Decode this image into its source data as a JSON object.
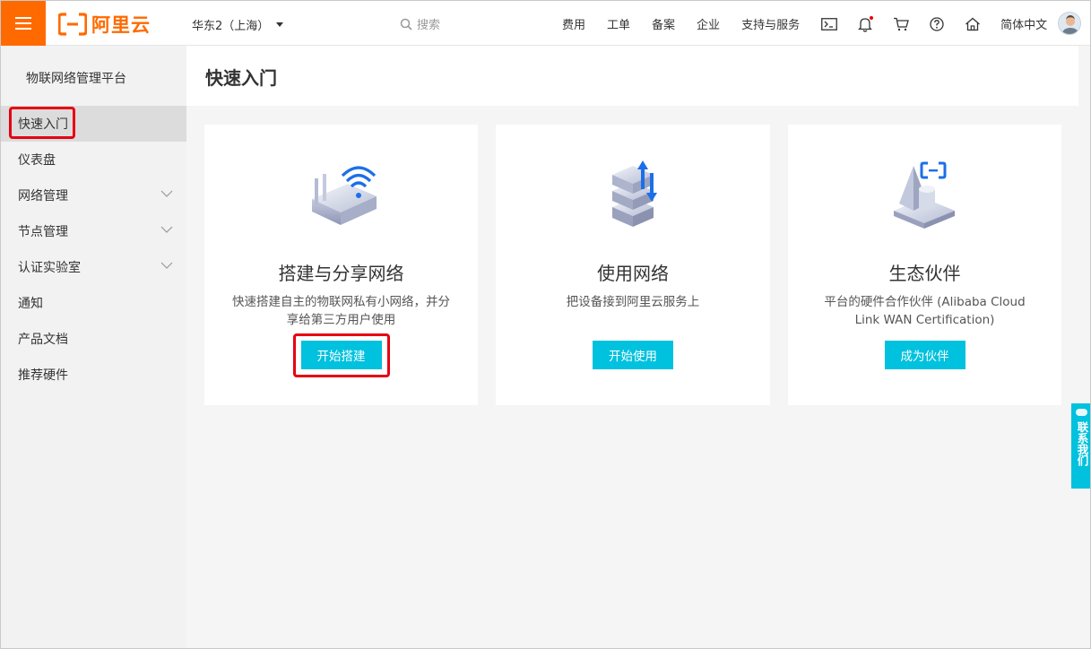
{
  "brand": {
    "logo_text": "阿里云",
    "color": "#ff6a00"
  },
  "header": {
    "region": "华东2（上海）",
    "search_placeholder": "搜索",
    "nav": [
      "费用",
      "工单",
      "备案",
      "企业",
      "支持与服务"
    ],
    "language": "简体中文",
    "icons": [
      "terminal-icon",
      "bell-icon",
      "cart-icon",
      "help-icon",
      "home-icon"
    ]
  },
  "sidebar": {
    "title": "物联网络管理平台",
    "items": [
      {
        "label": "快速入门",
        "active": true,
        "expandable": false
      },
      {
        "label": "仪表盘",
        "expandable": false
      },
      {
        "label": "网络管理",
        "expandable": true
      },
      {
        "label": "节点管理",
        "expandable": true
      },
      {
        "label": "认证实验室",
        "expandable": true
      },
      {
        "label": "通知",
        "expandable": false
      },
      {
        "label": "产品文档",
        "expandable": false
      },
      {
        "label": "推荐硬件",
        "expandable": false
      }
    ]
  },
  "page": {
    "title": "快速入门"
  },
  "cards": [
    {
      "icon": "router-wifi-icon",
      "title": "搭建与分享网络",
      "desc": "快速搭建自主的物联网私有小网络，并分享给第三方用户使用",
      "button": "开始搭建"
    },
    {
      "icon": "server-transfer-icon",
      "title": "使用网络",
      "desc": "把设备接到阿里云服务上",
      "button": "开始使用"
    },
    {
      "icon": "partner-cube-icon",
      "title": "生态伙伴",
      "desc": "平台的硬件合作伙伴 (Alibaba Cloud Link WAN Certification)",
      "button": "成为伙伴"
    }
  ],
  "float_contact": {
    "label": "联系我们"
  },
  "colors": {
    "accent": "#00c1de",
    "highlight": "#e60012"
  }
}
